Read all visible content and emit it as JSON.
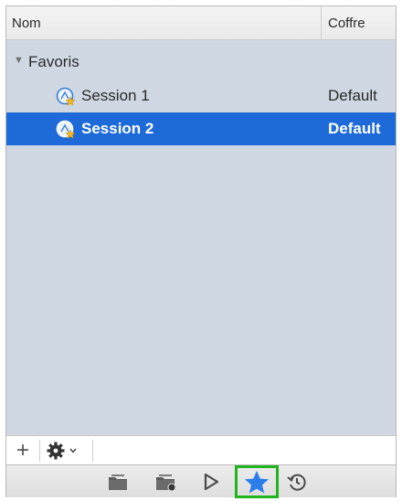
{
  "columns": {
    "name": "Nom",
    "vault": "Coffre"
  },
  "group": {
    "label": "Favoris",
    "expanded": true
  },
  "sessions": [
    {
      "label": "Session 1",
      "vault": "Default",
      "selected": false
    },
    {
      "label": "Session 2",
      "vault": "Default",
      "selected": true
    }
  ],
  "toolbar_top": {
    "add": "+"
  },
  "toolbar_bottom": {
    "items": [
      "folder-icon",
      "folder-settings-icon",
      "play-icon",
      "star-icon",
      "history-icon"
    ],
    "active": "star-icon"
  },
  "colors": {
    "list_background": "#cfd8e2",
    "selection": "#1d6ad8",
    "highlight_box": "#20b41e",
    "star": "#2b7de9"
  }
}
